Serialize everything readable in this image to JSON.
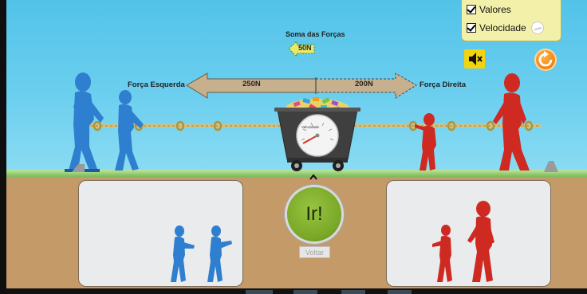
{
  "checkboxes": {
    "values": {
      "label": "Valores",
      "checked": true
    },
    "speed": {
      "label": "Velocidade",
      "checked": true
    }
  },
  "forces": {
    "sum_title": "Soma das Forças",
    "sum_value": "50N",
    "left_label": "Força Esquerda",
    "right_label": "Força Direita",
    "left_value": "250N",
    "right_value": "200N"
  },
  "speedometer": {
    "label": "Velocidade"
  },
  "controls": {
    "go_label": "Ir!",
    "back_label": "Voltar"
  },
  "icons": {
    "mute": "speaker-mute-icon",
    "reset": "reset-icon",
    "chevron": "chevron-up-icon"
  },
  "colors": {
    "blue_team": "#2e7fcf",
    "red_team": "#cf2a22",
    "go_button": "#7aa827",
    "checkbox_panel": "#f3f0a9",
    "reset_button": "#f07f08",
    "mute_button": "#f1d30f"
  }
}
